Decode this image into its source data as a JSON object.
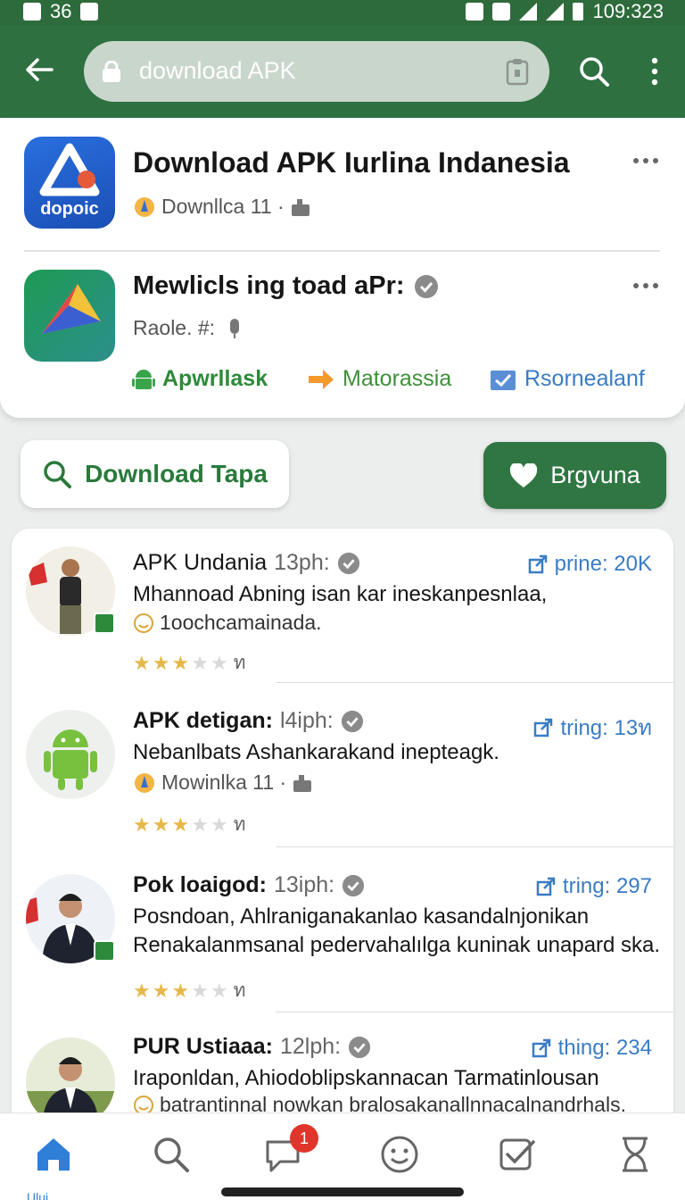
{
  "status_bar": {
    "left_number": "36",
    "time": "109:323"
  },
  "search": {
    "value": "download APK"
  },
  "featured": [
    {
      "icon_label": "dopoic",
      "title": "Download APK Iurlina Indanesia",
      "meta": "Downllca 11 ·"
    },
    {
      "title": "Mewlicls ing toad aPr:",
      "meta": "Raole. #:"
    }
  ],
  "chips": [
    "Apwrllask",
    "Matorassia",
    "Rsornealanf"
  ],
  "buttons": {
    "download": "Download Tapa",
    "secondary": "Brgvuna"
  },
  "posts": [
    {
      "title": "APK Undania",
      "time": "13ph:",
      "trend": "prine: 20K",
      "desc": [
        "Mhannoad Abning isan kar ineskanpesnlaa,"
      ],
      "sub": "1oochcamainada.",
      "rating_count": "ท",
      "avatar": "person-outdoor"
    },
    {
      "title": "APK detigan:",
      "time": "l4iph:",
      "trend": "tring: 13ท",
      "desc": [
        "Nebanlbats Ashankarakand ineptеagk."
      ],
      "sub": "Mowinlka 11 ·",
      "rating_count": "ท",
      "avatar": "android-robot"
    },
    {
      "title": "Pok loaigod:",
      "time": "13iph:",
      "trend": "tring: 297",
      "desc": [
        "Posndoan, Ahlraniganakanlao kasandalnjonikan",
        "Renakalanmsanal pedervahalılga kuninak unapard ska..."
      ],
      "sub": "",
      "rating_count": "ท",
      "avatar": "person-suit"
    },
    {
      "title": "PUR Ustiaaa:",
      "time": "12lph:",
      "trend": "thing: 234",
      "desc": [
        "Iraponldan, Ahiodoblipskannacan Tarmatinlousan"
      ],
      "sub": "batrantinnal nowkan bralosakanallnnacalnandrhals.",
      "rating_count": "",
      "avatar": "person-suit-2"
    }
  ],
  "bottom_nav": {
    "home_label": "Ului",
    "notification_count": "1"
  },
  "colors": {
    "primary_green": "#2f7040",
    "link_blue": "#3a7cc4",
    "star": "#e6b84a",
    "badge_red": "#e0352b"
  }
}
